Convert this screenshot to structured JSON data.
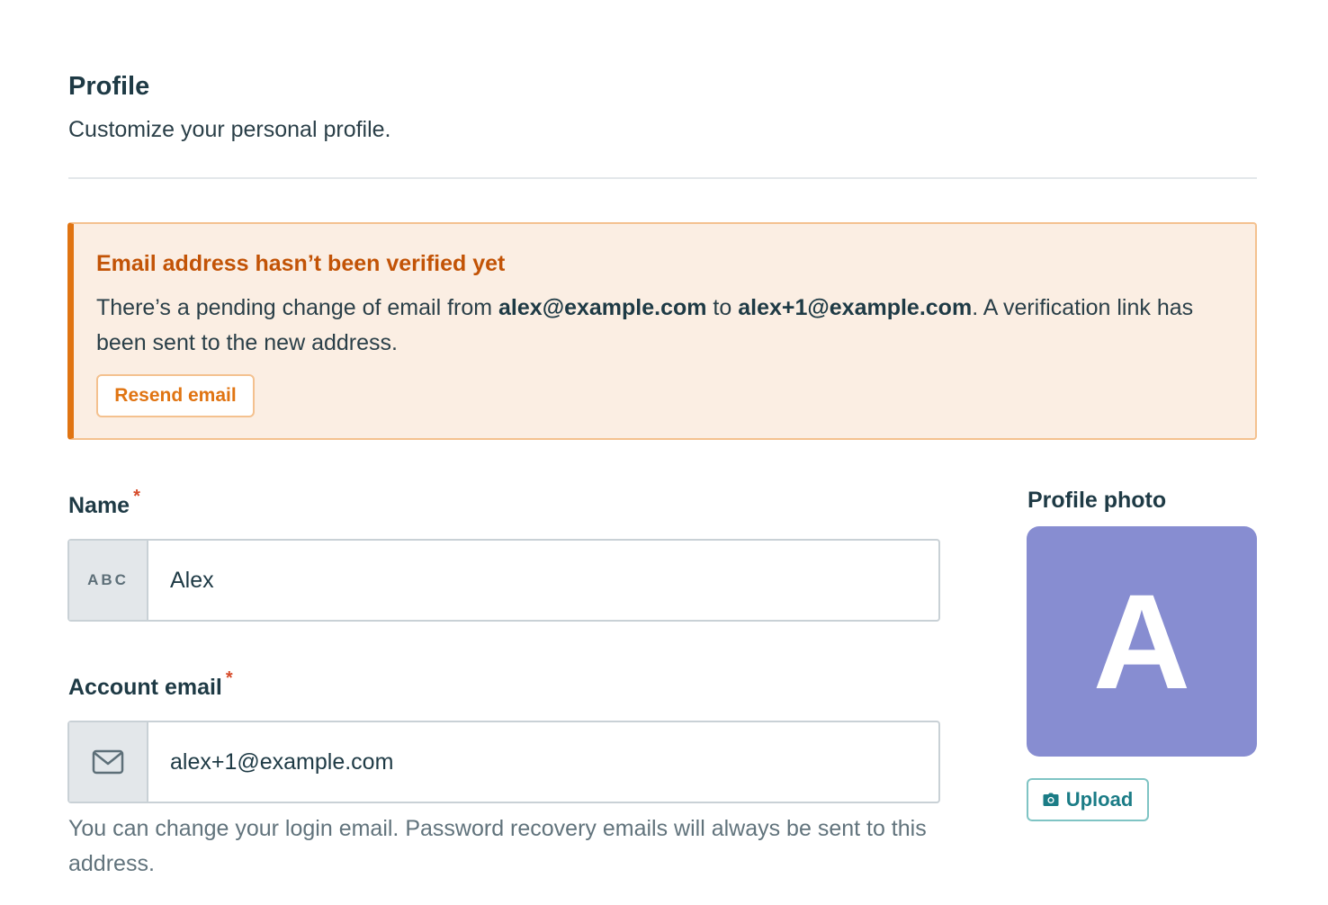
{
  "header": {
    "title": "Profile",
    "subtitle": "Customize your personal profile."
  },
  "alert": {
    "title": "Email address hasn’t been verified yet",
    "body_prefix": "There’s a pending change of email from ",
    "old_email": "alex@example.com",
    "body_middle": " to ",
    "new_email": "alex+1@example.com",
    "body_suffix": ". A verification link has been sent to the new address.",
    "resend_label": "Resend email",
    "accent_color": "#e07412"
  },
  "form": {
    "name": {
      "label": "Name",
      "required_mark": "*",
      "addon_text": "ABC",
      "value": "Alex"
    },
    "email": {
      "label": "Account email",
      "required_mark": "*",
      "addon_icon": "envelope-icon",
      "value": "alex+1@example.com",
      "help_text": "You can change your login email. Password recovery emails will always be sent to this address."
    }
  },
  "photo": {
    "label": "Profile photo",
    "initial": "A",
    "avatar_color": "#878dd1",
    "upload_label": "Upload",
    "upload_icon": "camera-icon"
  }
}
